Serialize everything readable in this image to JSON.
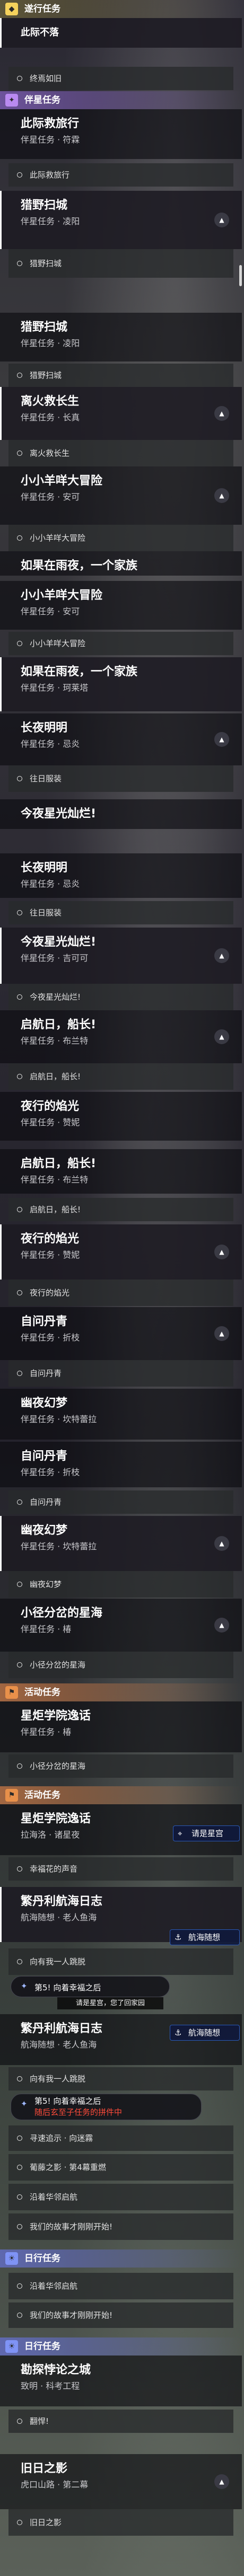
{
  "sections": {
    "daily": "遂行任务",
    "companion1": "伴星任务",
    "activity1": "活动任务",
    "activity2": "活动任务",
    "daily2": "日行任务",
    "daily3": "日行任务"
  },
  "quests": {
    "q01": {
      "title": "此际救旅行",
      "sub": "伴星任务 · 符霖"
    },
    "q02": {
      "title": "猎野扫城",
      "sub": "伴星任务 · 凌阳"
    },
    "q03": {
      "title": "猎野扫城",
      "sub": "伴星任务 · 凌阳"
    },
    "q04": {
      "title": "离火救长生",
      "sub": "伴星任务 · 长真"
    },
    "q05": {
      "title": "小小羊咩大冒险",
      "sub": "伴星任务 · 安可"
    },
    "q06": {
      "title": "小小羊咩大冒险",
      "sub": "伴星任务 · 安可"
    },
    "q07": {
      "title": "如果在雨夜，一个家族",
      "sub": "伴星任务 · 珂莱塔"
    },
    "q08": {
      "title": "长夜明明",
      "sub": "伴星任务 · 忌炎"
    },
    "q09": {
      "title": "今夜星光灿烂!",
      "sub": "伴星任务 · 吉可可"
    },
    "q10": {
      "title": "长夜明明",
      "sub": "伴星任务 · 忌炎"
    },
    "q11": {
      "title": "今夜星光灿烂!",
      "sub": "伴星任务 · 吉可可"
    },
    "q12": {
      "title": "启航日，船长!",
      "sub": "伴星任务 · 布兰特"
    },
    "q13": {
      "title": "夜行的焰光",
      "sub": "伴星任务 · 赞妮"
    },
    "q14": {
      "title": "启航日，船长!",
      "sub": "伴星任务 · 布兰特"
    },
    "q15": {
      "title": "夜行的焰光",
      "sub": "伴星任务 · 赞妮"
    },
    "q16": {
      "title": "自问丹青",
      "sub": "伴星任务 · 折枝"
    },
    "q17": {
      "title": "幽夜幻梦",
      "sub": "伴星任务 · 坎特蕾拉"
    },
    "q18": {
      "title": "自问丹青",
      "sub": "伴星任务 · 折枝"
    },
    "q19": {
      "title": "幽夜幻梦",
      "sub": "伴星任务 · 坎特蕾拉"
    },
    "q20": {
      "title": "小径分岔的星海",
      "sub": "伴星任务 · 椿"
    },
    "q21": {
      "title": "星炬学院逸话",
      "sub": "伴星任务 · 椿"
    },
    "q22": {
      "title": "星炬学院逸话",
      "sub": "拉海洛 · 诸星夜"
    },
    "q23": {
      "title": "繁丹利航海日志",
      "sub": "航海随想 · 老人鱼海"
    },
    "q24": {
      "title": "繁丹利航海日志",
      "sub": "航海随想 · 老人鱼海"
    },
    "q25": {
      "title": "勘探悖论之城",
      "sub": "致明 · 科考工程"
    },
    "q26": {
      "title": "旧日之影",
      "sub": "虎口山路 · 第二幕"
    }
  },
  "objectives": {
    "o01": "终焉如旧",
    "o02": "此际救旅行",
    "o03": "猎野扫城",
    "o04": "猎野扫城",
    "o05": "离火救长生",
    "o06": "小小羊咩大冒险",
    "o07": "如果在雨夜，一个家族",
    "o08": "小小羊咩大冒险",
    "o09": "往日服装",
    "o10": "往日服装",
    "o11": "今夜星光灿烂!",
    "o12": "启航日，船长!",
    "o13": "启航日，船长!",
    "o14": "夜行的焰光",
    "o15": "自问丹青",
    "o16": "自问丹青",
    "o17": "幽夜幻梦",
    "o18": "小径分岔的星海",
    "o19": "小径分岔的星海",
    "o20": "幸福花的声音",
    "o21": "向有我一人跳脱",
    "o22": "向有我一人跳脱",
    "o23": "寻速追示 · 向迷霧",
    "o24": "葡藤之影 · 第4幕重燃",
    "o25": "沿着华邻启航",
    "o26": "我们的故事才刚刚开始!",
    "o27": "沿着华邻启航",
    "o28": "我们的故事才刚刚开始!",
    "o29": "翻悍!",
    "o30": "旧日之影"
  },
  "selected_quest": "此际不落",
  "badges": {
    "b1": "请是星宫",
    "b2": "航海随想",
    "b3": "航海随想"
  },
  "pills": {
    "p1": "第5! 向着幸福之后",
    "p2": "第5! 向着幸福之后"
  },
  "tips": {
    "t1": "请是星宫，您了回家园",
    "t2": "随后玄至子任务的拼件中"
  },
  "colors": {
    "daily": "#f5d25c",
    "companion": "#b98af0",
    "activity": "#e8904a",
    "dailyBlue": "#7f93f5",
    "badge_border": "#2a5ab8"
  }
}
